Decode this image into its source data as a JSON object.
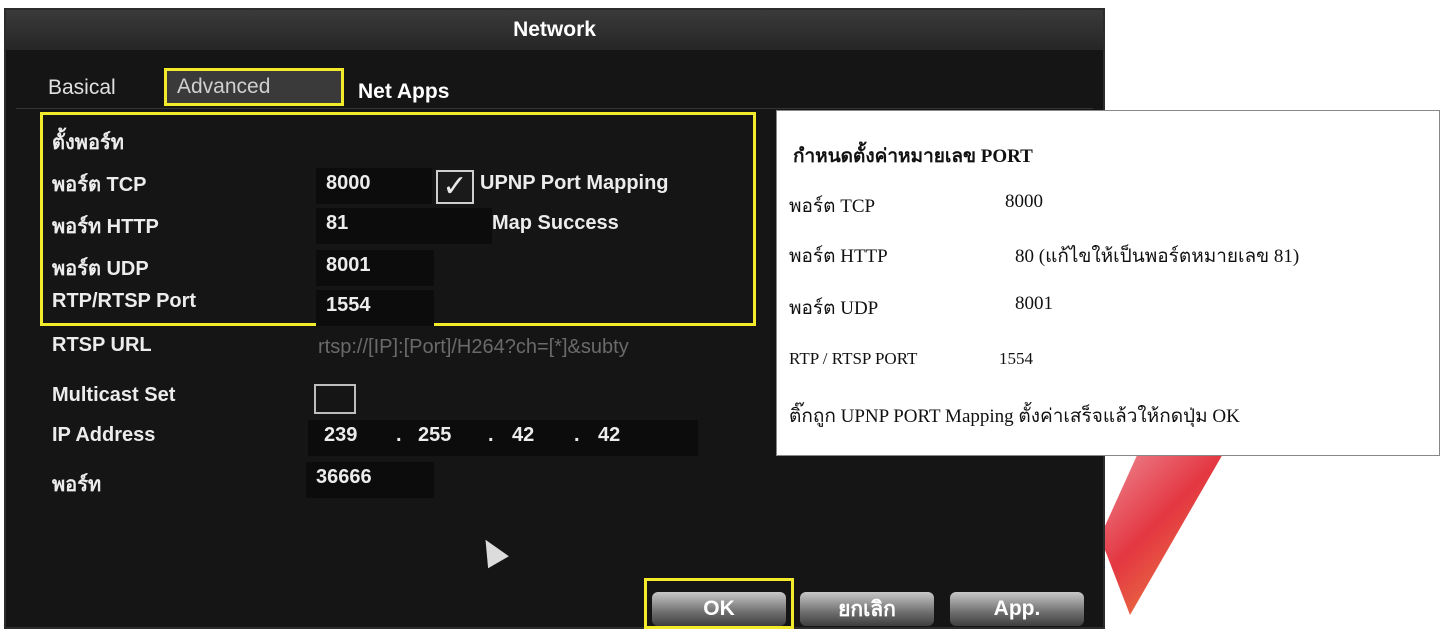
{
  "window": {
    "title": "Network"
  },
  "tabs": {
    "basical": "Basical",
    "advanced": "Advanced",
    "netapps": "Net Apps"
  },
  "ports": {
    "section_title": "ตั้งพอร์ท",
    "tcp_label": "พอร์ต TCP",
    "tcp_value": "8000",
    "http_label": "พอร์ท HTTP",
    "http_value": "81",
    "udp_label": "พอร์ต UDP",
    "udp_value": "8001",
    "rtsp_label": "RTP/RTSP Port",
    "rtsp_value": "1554",
    "upnp_label": "UPNP Port Mapping",
    "upnp_checked": true,
    "map_status": "Map Success"
  },
  "rtsp_url": {
    "label": "RTSP URL",
    "value": "rtsp://[IP]:[Port]/H264?ch=[*]&subty"
  },
  "multicast": {
    "label": "Multicast Set",
    "ip_label": "IP Address",
    "ip": [
      "239",
      "255",
      "42",
      "42"
    ],
    "ip_sep": ".",
    "port_label": "พอร์ท",
    "port_value": "36666"
  },
  "buttons": {
    "ok": "OK",
    "cancel": "ยกเลิก",
    "app": "App."
  },
  "note": {
    "title": "กำหนดตั้งค่าหมายเลข PORT",
    "tcp_label": "พอร์ต  TCP",
    "tcp_value": "8000",
    "http_label": "พอร์ต  HTTP",
    "http_value": "80  (แก้ไขให้เป็นพอร์ตหมายเลข 81)",
    "udp_label": "พอร์ต  UDP",
    "udp_value": "8001",
    "rtsp_label": "RTP / RTSP PORT",
    "rtsp_value": "1554",
    "instruction": "ติ๊กถูก  UPNP  PORT  Mapping  ตั้งค่าเสร็จแล้วให้กดปุ่ม  OK"
  },
  "colors": {
    "highlight": "#f2ea2a",
    "window_bg": "#151515",
    "text": "#ececec"
  }
}
